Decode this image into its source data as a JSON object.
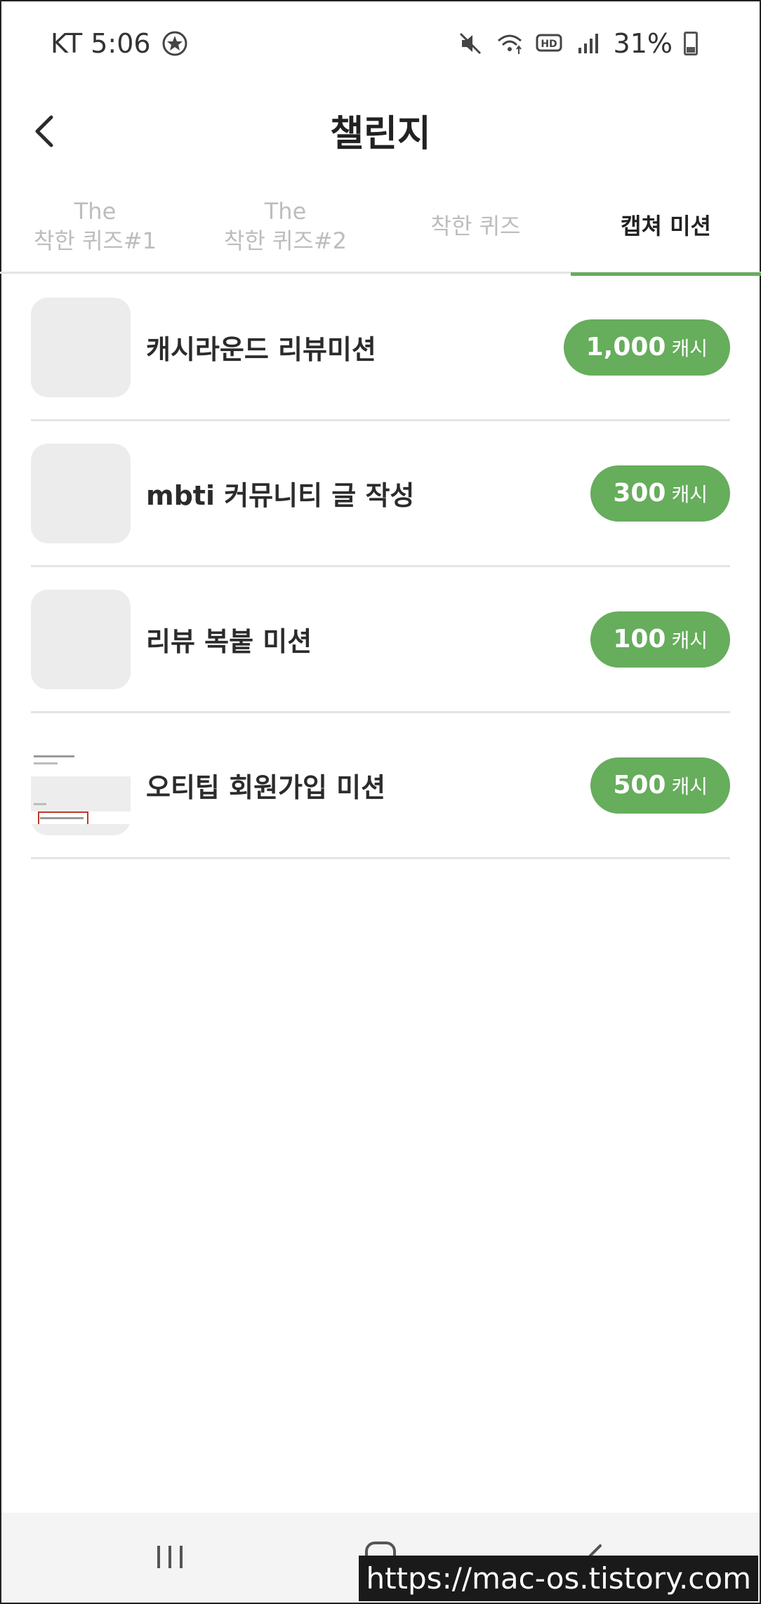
{
  "status_bar": {
    "carrier_time": "KT 5:06",
    "battery_percent": "31%",
    "icons": [
      "app-notification-icon",
      "mute-icon",
      "wifi-icon",
      "hd-voice-icon",
      "signal-icon",
      "battery-icon"
    ]
  },
  "header": {
    "title": "챌린지",
    "back_icon": "chevron-left-icon"
  },
  "tabs": [
    {
      "line1": "The",
      "line2": "착한 퀴즈#1",
      "active": false
    },
    {
      "line1": "The",
      "line2": "착한 퀴즈#2",
      "active": false
    },
    {
      "line1": "",
      "line2": "착한 퀴즈",
      "active": false
    },
    {
      "line1": "",
      "line2": "캡쳐 미션",
      "active": true
    }
  ],
  "missions": [
    {
      "title": "캐시라운드 리뷰미션",
      "amount": "1,000",
      "unit": "캐시"
    },
    {
      "title": "mbti 커뮤니티 글 작성",
      "amount": "300",
      "unit": "캐시"
    },
    {
      "title": "리뷰 복붙 미션",
      "amount": "100",
      "unit": "캐시"
    },
    {
      "title": "오티팁 회원가입 미션",
      "amount": "500",
      "unit": "캐시"
    }
  ],
  "nav_bar": {
    "icons": [
      "recent-apps-icon",
      "home-icon",
      "back-icon"
    ]
  },
  "watermark": "https://mac-os.tistory.com",
  "colors": {
    "accent": "#66ad5c",
    "tab_inactive": "#bdbdbd",
    "divider": "#e4e4e4"
  }
}
